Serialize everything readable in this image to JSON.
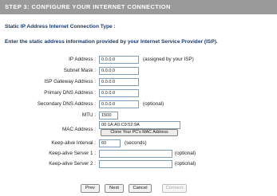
{
  "header": {
    "title": "STEP 3: CONFIGURE YOUR INTERNET CONNECTION"
  },
  "section": {
    "subtitle": "Static IP Address Internet Connection Type :",
    "description": "Enter the static address information provided by your Internet Service Provider (ISP)."
  },
  "form": {
    "ip_address": {
      "label": "IP Address :",
      "value": "0.0.0.0",
      "note": "(assigned by your ISP)"
    },
    "subnet_mask": {
      "label": "Subnet Mask :",
      "value": "0.0.0.0"
    },
    "isp_gateway": {
      "label": "ISP Gateway Address :",
      "value": "0.0.0.0"
    },
    "primary_dns": {
      "label": "Primary DNS Address :",
      "value": "0.0.0.0"
    },
    "secondary_dns": {
      "label": "Secondary DNS Address :",
      "value": "0.0.0.0",
      "note": "(optional)"
    },
    "mtu": {
      "label": "MTU :",
      "value": "1500"
    },
    "mac_address": {
      "label": "MAC Address :",
      "value": "00:1A:A0:C9:52:9A",
      "clone_label": "Clone Your PC's MAC Address"
    },
    "keepalive_interval": {
      "label": "Keep-alive Interval :",
      "value": "60",
      "note": "(seconds)"
    },
    "keepalive_server1": {
      "label": "Keep-alive Server 1 :",
      "value": "",
      "note": "(optional)"
    },
    "keepalive_server2": {
      "label": "Keep-alive Server 2 :",
      "value": "",
      "note": "(optional)"
    }
  },
  "buttons": {
    "prev": "Prev",
    "next": "Next",
    "cancel": "Cancel",
    "connect": "Connect"
  }
}
